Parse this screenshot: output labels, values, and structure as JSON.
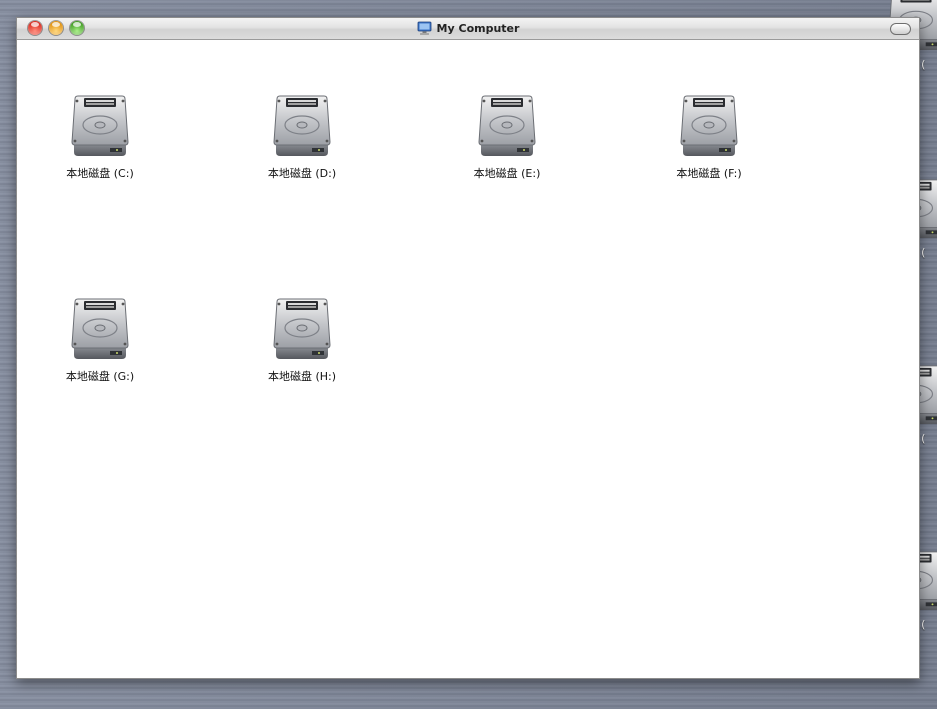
{
  "window": {
    "title": "My Computer",
    "title_icon": "computer-icon"
  },
  "drives": [
    {
      "label": "本地磁盘 (C:)",
      "icon": "hard-drive-icon"
    },
    {
      "label": "本地磁盘 (D:)",
      "icon": "hard-drive-icon"
    },
    {
      "label": "本地磁盘 (E:)",
      "icon": "hard-drive-icon"
    },
    {
      "label": "本地磁盘 (F:)",
      "icon": "hard-drive-icon"
    },
    {
      "label": "本地磁盘 (G:)",
      "icon": "hard-drive-icon"
    },
    {
      "label": "本地磁盘 (H:)",
      "icon": "hard-drive-icon"
    }
  ],
  "desktop_icons": [
    {
      "label": "盘 (",
      "icon": "hard-drive-icon"
    },
    {
      "label": "盘 (",
      "icon": "hard-drive-icon"
    },
    {
      "label": "盘 (",
      "icon": "hard-drive-icon"
    },
    {
      "label": "盘 (",
      "icon": "hard-drive-icon"
    }
  ],
  "colors": {
    "desktop": "#7d8597",
    "window_bg": "#ffffff",
    "close": "#d8281b",
    "minimize": "#e0900c",
    "zoom": "#3e9b1f"
  }
}
